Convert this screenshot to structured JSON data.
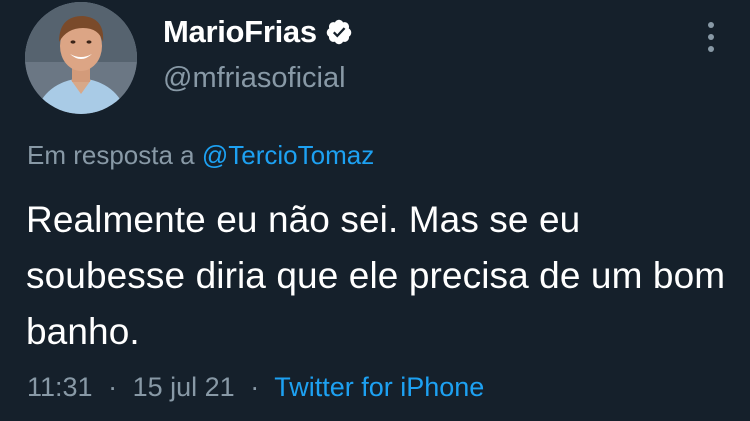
{
  "author": {
    "display_name": "MarioFrias",
    "handle": "@mfriasoficial",
    "verified_icon": "verified-badge-icon",
    "avatar_icon": "avatar"
  },
  "reply": {
    "prefix": "Em resposta a",
    "mention": "@TercioTomaz"
  },
  "tweet": {
    "text": "Realmente eu não sei. Mas se eu soubesse diria que ele precisa de um bom banho."
  },
  "meta": {
    "time": "11:31",
    "separator": "·",
    "date": "15 jul 21",
    "source": "Twitter for iPhone"
  },
  "icons": {
    "more": "more-vertical-icon"
  },
  "colors": {
    "background": "#15202b",
    "text": "#ffffff",
    "secondary": "#8899a6",
    "accent": "#1da1f2"
  }
}
